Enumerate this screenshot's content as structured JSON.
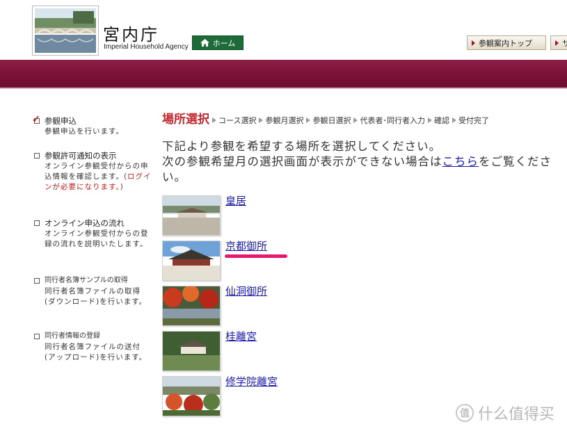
{
  "header": {
    "agency_name_jp": "宮内庁",
    "agency_name_en": "Imperial Household Agency",
    "home_label": "ホーム",
    "top_buttons": [
      "参観案内トップ",
      "サ"
    ]
  },
  "sidebar": {
    "items": [
      {
        "title": "参観申込",
        "desc": "参観申込を行います。",
        "checked": true
      },
      {
        "title": "参観許可通知の表示",
        "desc": "オンライン参観受付からの申込情報を確認します。",
        "note": "(ログインが必要になります。)"
      },
      {
        "title": "オンライン申込の流れ",
        "desc": "オンライン参観受付からの登録の流れを説明いたします。"
      },
      {
        "title": "同行者名簿サンプルの取得",
        "desc": "同行者名簿ファイルの取得(ダウンロード)を行います。"
      },
      {
        "title": "同行者情報の登録",
        "desc": "同行者名簿ファイルの送付(アップロード)を行います。"
      }
    ]
  },
  "breadcrumb": {
    "current": "場所選択",
    "steps": [
      "コース選択",
      "参観月選択",
      "参観日選択",
      "代表者･同行者入力",
      "確認",
      "受付完了"
    ]
  },
  "instructions": {
    "line1": "下記より参観を希望する場所を選択してください。",
    "line2_before": "次の参観希望月の選択画面が表示ができない場合は",
    "line2_link": "こちら",
    "line2_after": "をご覧ください。"
  },
  "locations": [
    "皇居",
    "京都御所",
    "仙洞御所",
    "桂離宮",
    "修学院離宮"
  ],
  "colors": {
    "banner": "#7d1238",
    "accent_red": "#c1282f",
    "link": "#1a1aa6",
    "home_button": "#1e6b3a",
    "highlight": "#e8186e"
  },
  "watermark": "什么值得买"
}
